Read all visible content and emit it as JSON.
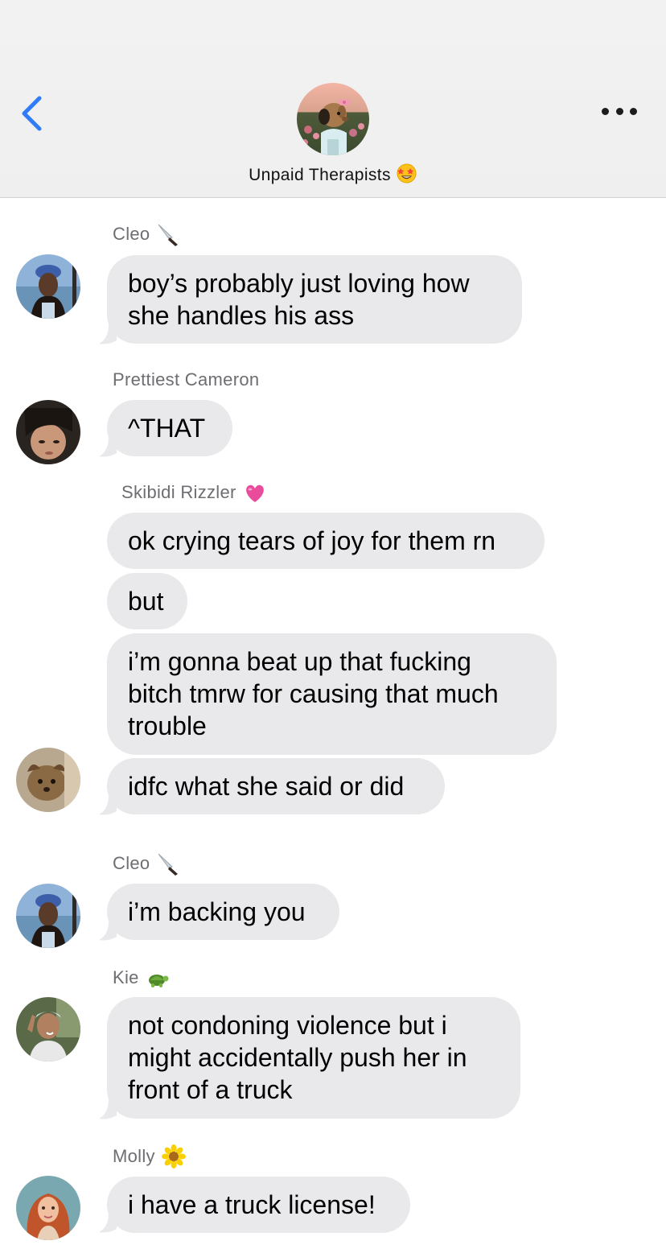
{
  "header": {
    "group_name": "Unpaid Therapists",
    "group_emoji": "star-struck-emoji"
  },
  "messages": [
    {
      "sender": "Cleo",
      "sender_emoji": "knife-emoji",
      "text": "boy’s probably just loving how\nshe handles his ass"
    },
    {
      "sender": "Prettiest Cameron",
      "text": "^THAT"
    },
    {
      "sender": "Skibidi Rizzler",
      "sender_emoji": "pink-heart-emoji",
      "text": "ok crying tears of joy for them rn"
    },
    {
      "text": "but"
    },
    {
      "text": "i’m gonna beat up that fucking\nbitch tmrw for causing that much\ntrouble"
    },
    {
      "text": "idfc what she said or did"
    },
    {
      "sender": "Cleo",
      "sender_emoji": "knife-emoji",
      "text": "i’m backing you"
    },
    {
      "sender": "Kie",
      "sender_emoji": "turtle-emoji",
      "text": "not condoning violence but i\nmight accidentally push her in\nfront of a truck"
    },
    {
      "sender": "Molly",
      "sender_emoji": "sunflower-emoji",
      "text": "i have a truck license!"
    }
  ],
  "colors": {
    "accent": "#2f7cf6",
    "bubble": "#e9e9eb",
    "sender_text": "#6d6d72",
    "header_bg": "#f0f0f0"
  }
}
